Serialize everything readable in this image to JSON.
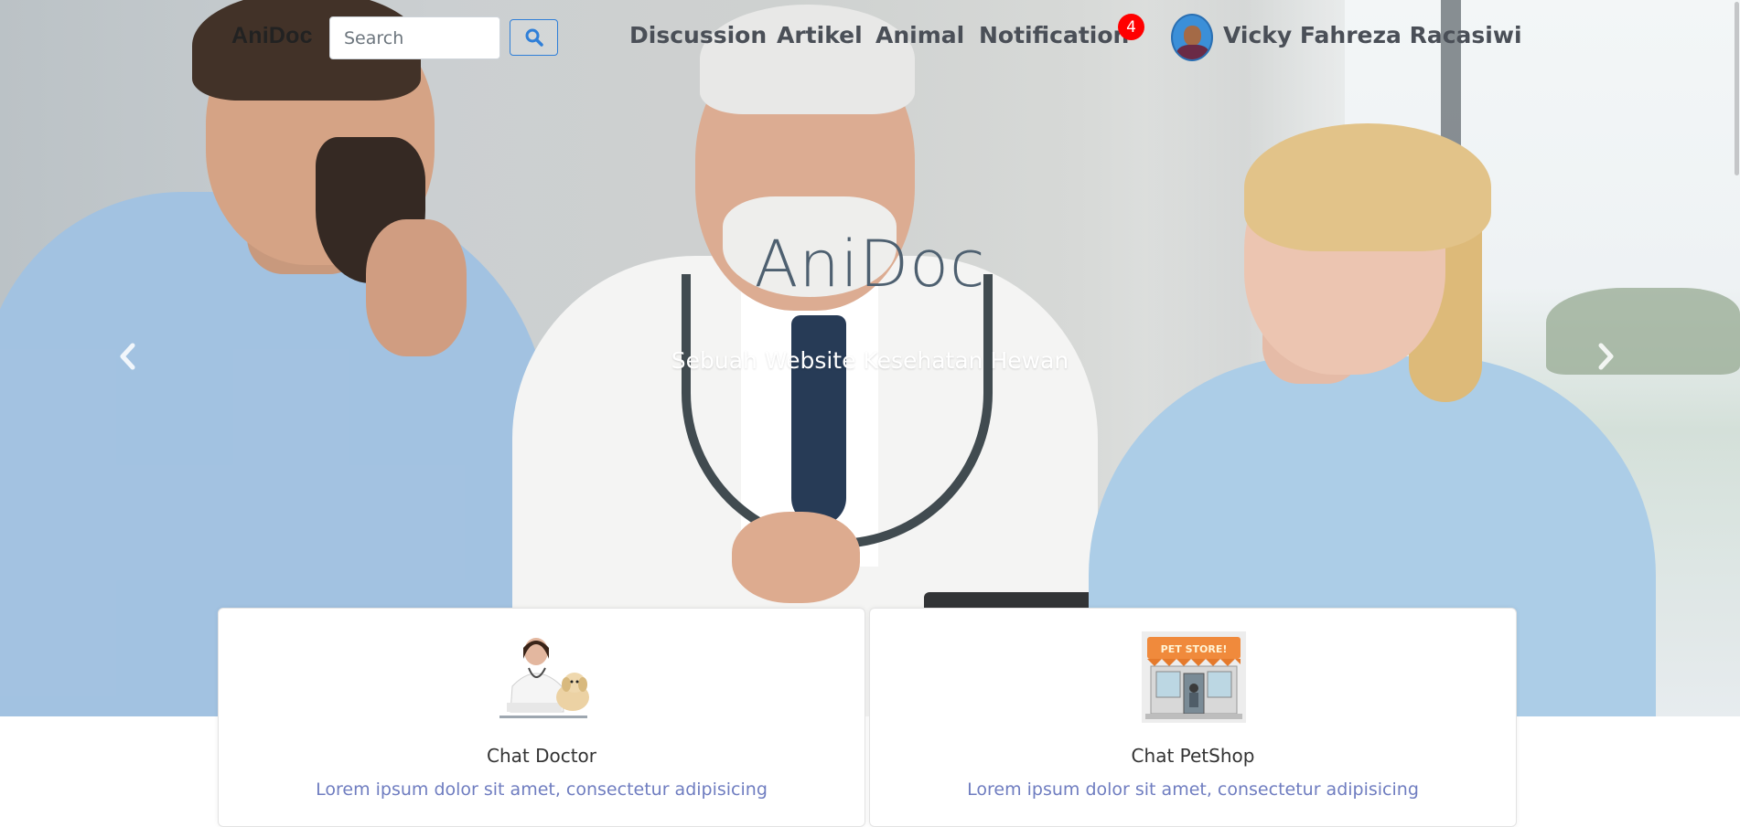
{
  "nav": {
    "brand": "AniDoc",
    "search": {
      "placeholder": "Search",
      "value": ""
    },
    "links": [
      "Discussion",
      "Artikel",
      "Animal",
      "Notification"
    ],
    "notification_count": "4",
    "user_name": "Vicky Fahreza Racasiwi"
  },
  "hero": {
    "title": "AniDoc",
    "subtitle": "Sebuah Website Kesehatan Hewan"
  },
  "cards": [
    {
      "title": "Chat Doctor",
      "text": "Lorem ipsum dolor sit amet, consectetur adipisicing",
      "icon": "doctor-with-dog-image"
    },
    {
      "title": "Chat PetShop",
      "text": "Lorem ipsum dolor sit amet, consectetur adipisicing",
      "icon": "pet-store-image"
    }
  ],
  "colors": {
    "badge": "#ff0000",
    "search_button_border": "#2f7fd8",
    "card_text": "#6f7dc0"
  }
}
